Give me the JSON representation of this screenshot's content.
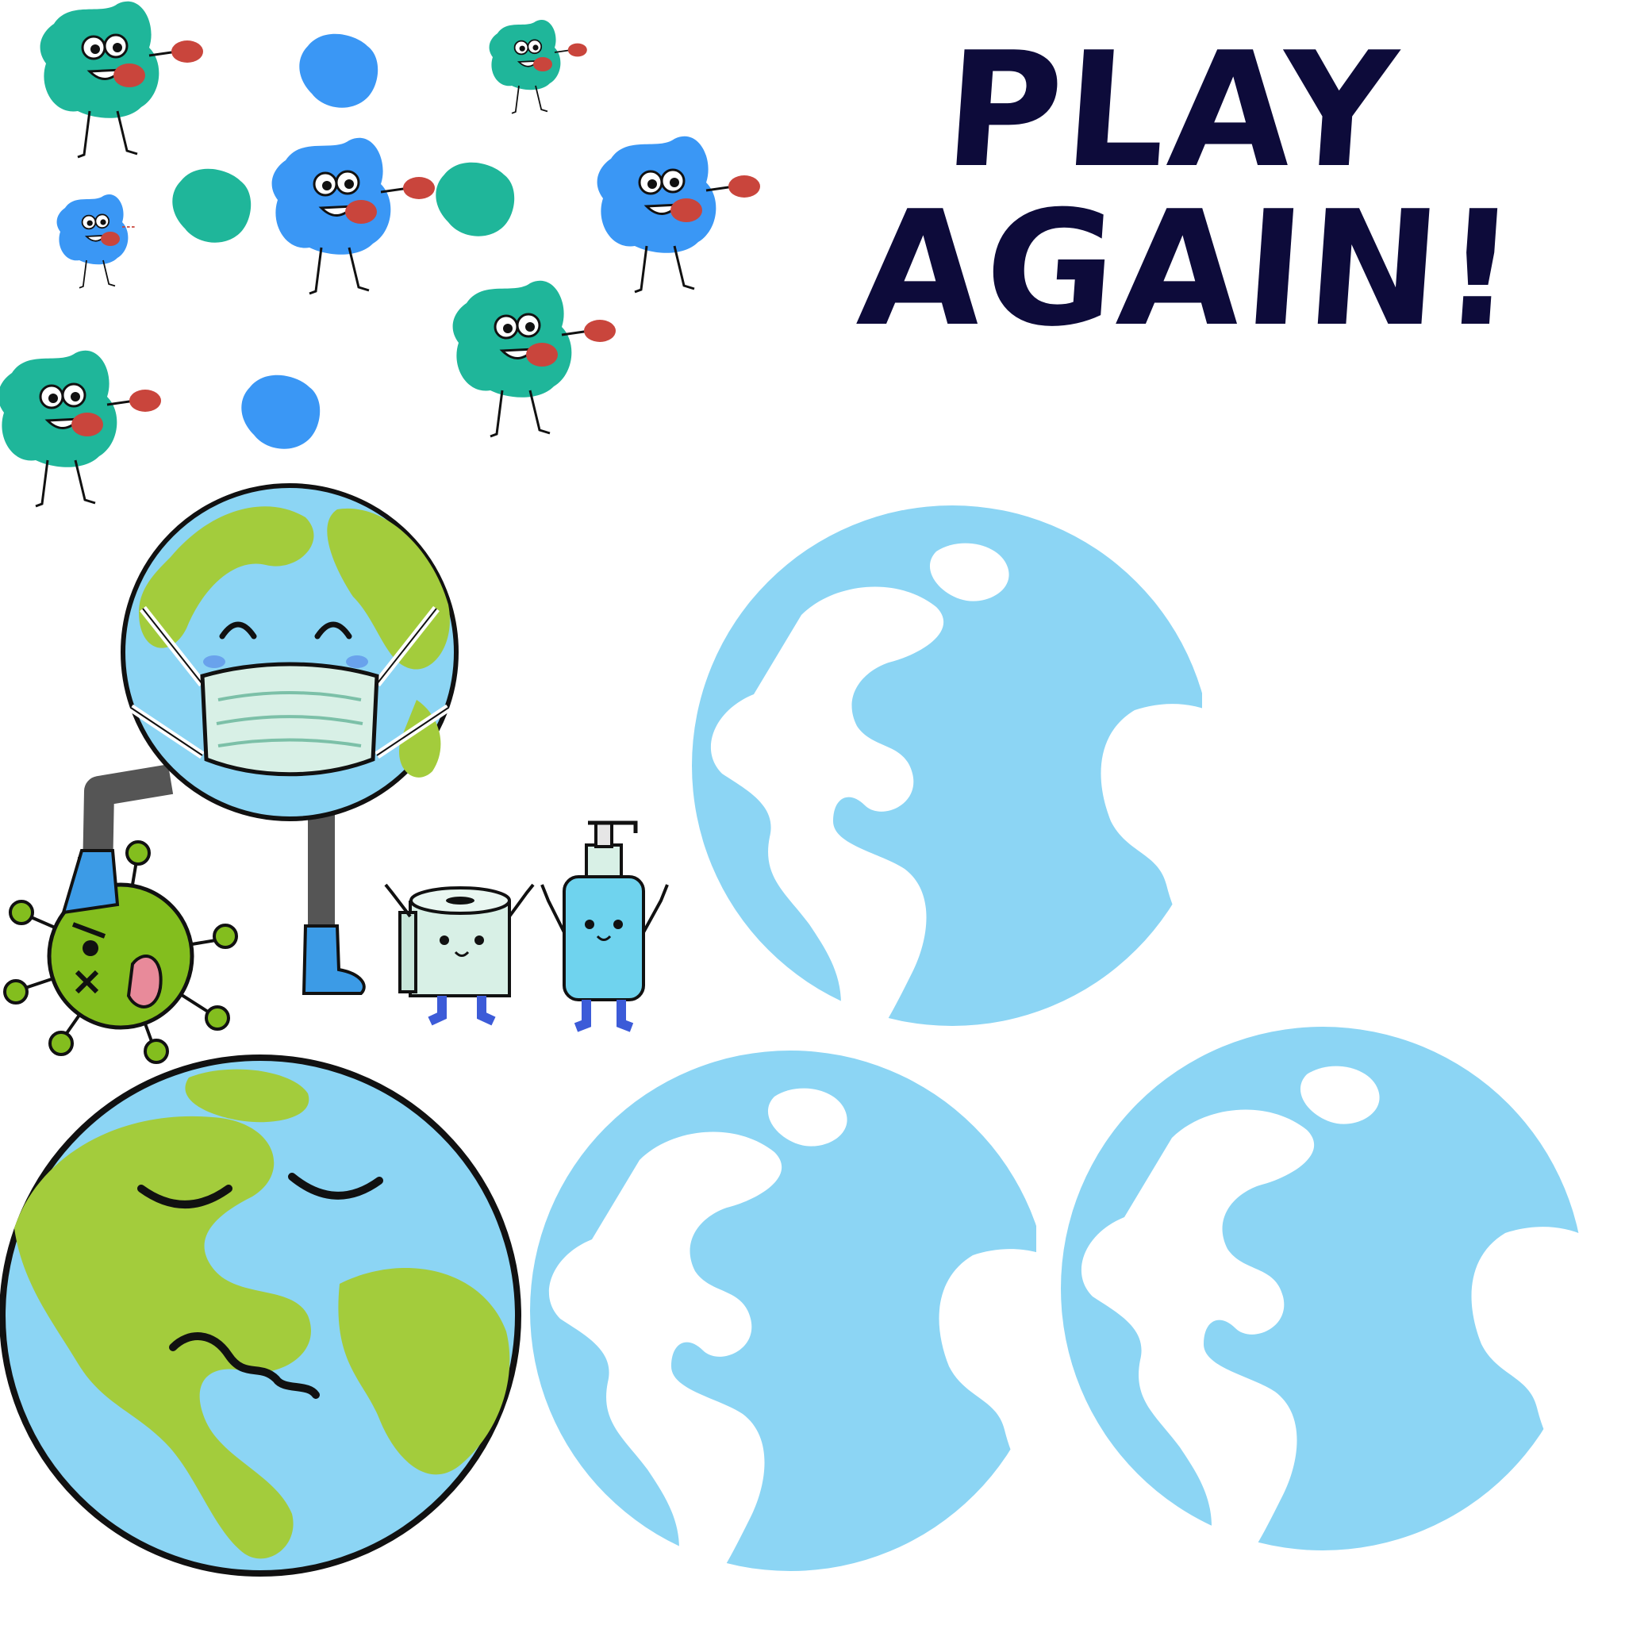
{
  "game_screen": {
    "play_again_line1": "PLAY",
    "play_again_line2": "AGAIN!"
  },
  "colors": {
    "title": "#0d0b3a",
    "ocean": "#8cd5f4",
    "land": "#a3cc3c",
    "germ_teal": "#1fb69a",
    "germ_blue": "#3a97f5",
    "glove": "#c9453c",
    "virus": "#83be1e",
    "outline": "#111111"
  },
  "icons": [
    "germ-character-icon",
    "germ-blob-icon",
    "masked-earth-icon",
    "defeated-virus-icon",
    "toilet-paper-icon",
    "sanitizer-bottle-icon",
    "sleeping-earth-icon",
    "faded-earth-icon"
  ]
}
